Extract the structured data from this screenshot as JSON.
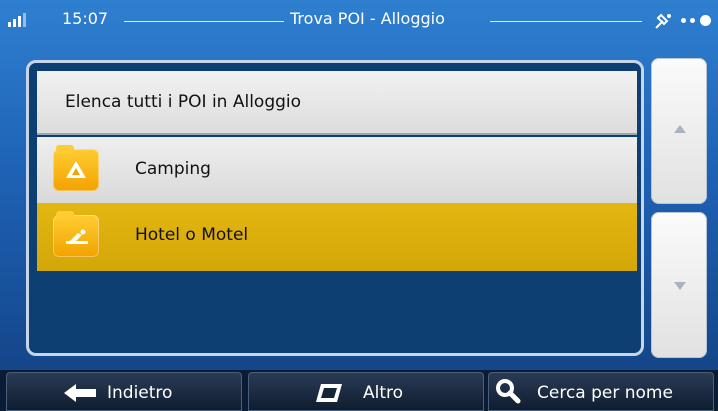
{
  "status_bar": {
    "time": "15:07",
    "title": "Trova POI - Alloggio",
    "icons": [
      "signal-icon",
      "gps-satellite-icon",
      "connection-dots-icon"
    ]
  },
  "list": {
    "header": "Elenca tutti i POI in Alloggio",
    "items": [
      {
        "label": "Camping",
        "icon": "camping-tent-icon",
        "selected": false
      },
      {
        "label": "Hotel o Motel",
        "icon": "hotel-bed-icon",
        "selected": true
      }
    ]
  },
  "scroll": {
    "up_icon": "scroll-up-arrow-icon",
    "down_icon": "scroll-down-arrow-icon"
  },
  "bottom_bar": {
    "back_label": "Indietro",
    "more_label": "Altro",
    "search_label": "Cerca per nome"
  },
  "colors": {
    "background": "#1f63b6",
    "selected_row": "#dcae0d",
    "folder_icon": "#f7b500",
    "bottom_bar": "#0f1d30"
  }
}
